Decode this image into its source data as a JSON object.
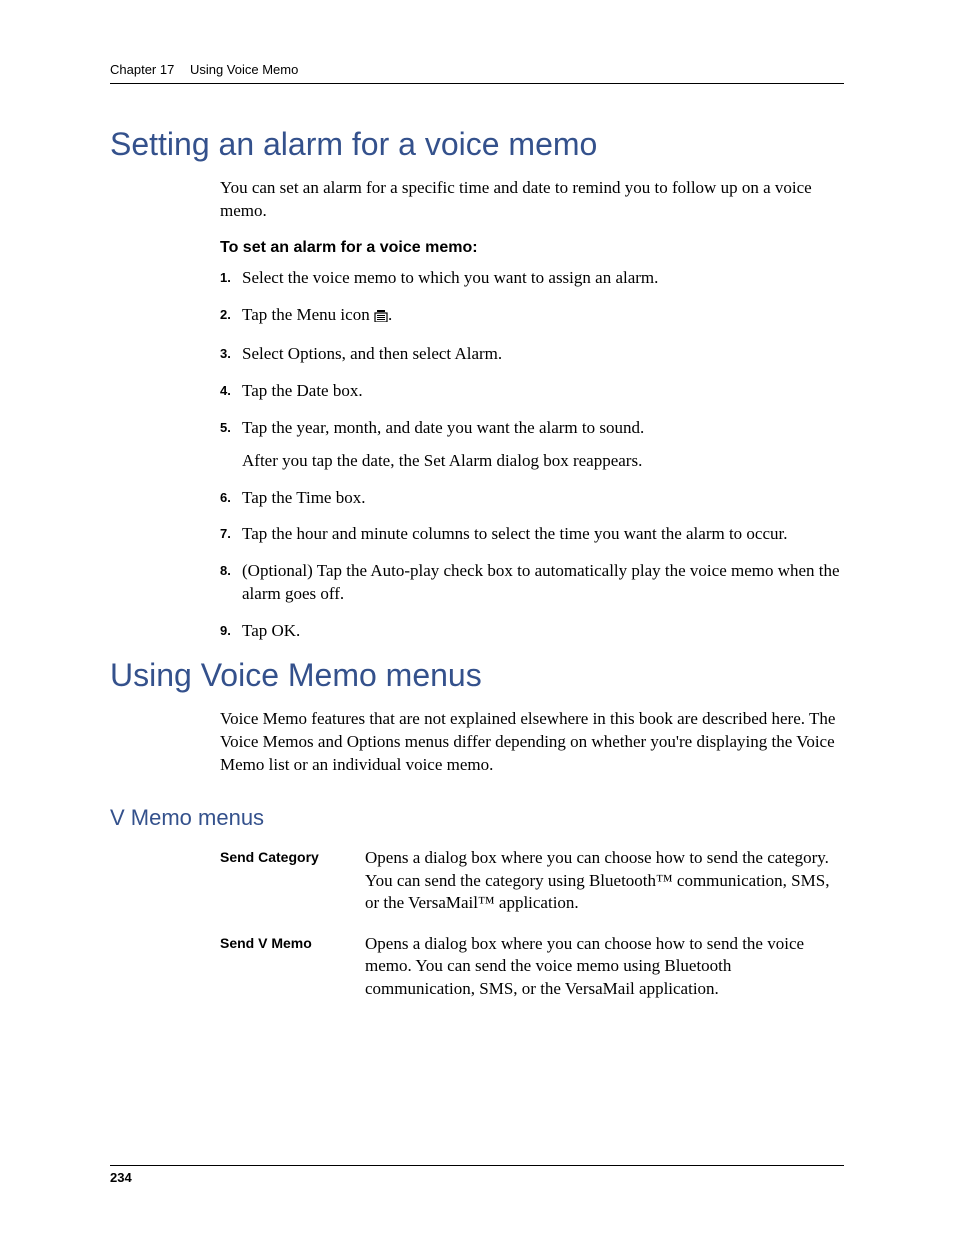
{
  "header": {
    "chapter": "Chapter 17",
    "title": "Using Voice Memo"
  },
  "section1": {
    "title": "Setting an alarm for a voice memo",
    "intro": "You can set an alarm for a specific time and date to remind you to follow up on a voice memo.",
    "proc_title": "To set an alarm for a voice memo:",
    "steps": [
      {
        "num": "1.",
        "text": "Select the voice memo to which you want to assign an alarm."
      },
      {
        "num": "2.",
        "text_pre": "Tap the Menu icon ",
        "icon_name": "menu-icon",
        "text_post": "."
      },
      {
        "num": "3.",
        "text": "Select Options, and then select Alarm."
      },
      {
        "num": "4.",
        "text": "Tap the Date box."
      },
      {
        "num": "5.",
        "text": "Tap the year, month, and date you want the alarm to sound.",
        "after": "After you tap the date, the Set Alarm dialog box reappears."
      },
      {
        "num": "6.",
        "text": "Tap the Time box."
      },
      {
        "num": "7.",
        "text": "Tap the hour and minute columns to select the time you want the alarm to occur."
      },
      {
        "num": "8.",
        "text": "(Optional) Tap the Auto-play check box to automatically play the voice memo when the alarm goes off."
      },
      {
        "num": "9.",
        "text": "Tap OK."
      }
    ]
  },
  "section2": {
    "title": "Using Voice Memo menus",
    "intro": "Voice Memo features that are not explained elsewhere in this book are described here. The Voice Memos and Options menus differ depending on whether you're displaying the Voice Memo list or an individual voice memo.",
    "sub_title": "V Memo menus",
    "rows": [
      {
        "term": "Send Category",
        "desc": "Opens a dialog box where you can choose how to send the category. You can send the category using Bluetooth™ communication, SMS, or the VersaMail™ application."
      },
      {
        "term": "Send V Memo",
        "desc": "Opens a dialog box where you can choose how to send the voice memo. You can send the voice memo using Bluetooth communication, SMS, or the VersaMail application."
      }
    ]
  },
  "footer": {
    "page_number": "234"
  }
}
